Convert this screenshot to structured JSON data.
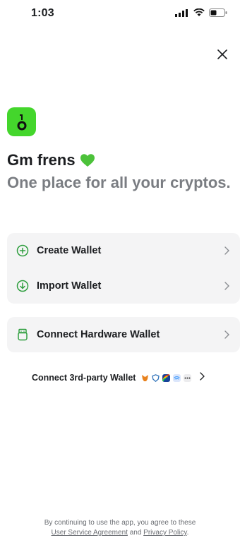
{
  "status_bar": {
    "time": "1:03"
  },
  "header": {
    "greeting": "Gm frens",
    "tagline": "One place for all your cryptos."
  },
  "actions": {
    "create_wallet": "Create Wallet",
    "import_wallet": "Import Wallet",
    "connect_hardware": "Connect Hardware Wallet",
    "connect_third_party": "Connect 3rd-party Wallet"
  },
  "third_party_icons": [
    "metamask-icon",
    "shield-wallet-icon",
    "rainbow-icon",
    "walletconnect-icon",
    "more-icon"
  ],
  "footer": {
    "line1": "By continuing to use the app, you agree to these",
    "user_agreement": "User Service Agreement",
    "and": " and ",
    "privacy_policy": "Privacy Policy",
    "period": "."
  },
  "colors": {
    "brand_green": "#44d62c",
    "card_bg": "#f4f4f5",
    "heart": "#4cc23a",
    "accent_icon": "#2e9e3e"
  }
}
